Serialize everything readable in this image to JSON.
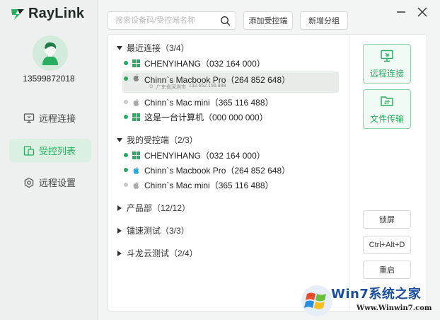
{
  "app": {
    "name": "RayLink",
    "brand_color": "#27ae60"
  },
  "user": {
    "id": "13599872018"
  },
  "sidebar": {
    "items": [
      {
        "label": "远程连接",
        "icon": "remote-desktop-icon",
        "active": false
      },
      {
        "label": "受控列表",
        "icon": "device-list-icon",
        "active": true
      },
      {
        "label": "远程设置",
        "icon": "settings-icon",
        "active": false
      }
    ]
  },
  "toolbar": {
    "search_placeholder": "搜索设备码/受控端名称",
    "add_device_label": "添加受控端",
    "add_group_label": "新增分组"
  },
  "groups": [
    {
      "label": "最近连接（3/4）",
      "expanded": true,
      "devices": [
        {
          "name": "CHENYIHANG（032 164 000）",
          "os": "windows",
          "online": true
        },
        {
          "name": "Chinn`s Macbook Pro（264 852 648）",
          "os": "mac",
          "online": true,
          "selected": true,
          "location": "广东省深圳市",
          "ip": "132.652.156.888"
        },
        {
          "name": "Chinn`s Mac mini（365 116 488）",
          "os": "mac",
          "online": false
        },
        {
          "name": "这是一台计算机（000 000 000）",
          "os": "windows",
          "online": true
        }
      ]
    },
    {
      "label": "我的受控端（2/3）",
      "expanded": true,
      "devices": [
        {
          "name": "CHENYIHANG（032 164 000）",
          "os": "windows",
          "online": true
        },
        {
          "name": "Chinn`s Macbook Pro（264 852 648）",
          "os": "mac",
          "online": true
        },
        {
          "name": "Chinn`s Mac mini（365 116 488）",
          "os": "mac",
          "online": false
        }
      ]
    },
    {
      "label": "产品部（12/12）",
      "expanded": false
    },
    {
      "label": "镭速测试（3/3）",
      "expanded": false
    },
    {
      "label": "斗龙云测试（2/4）",
      "expanded": false
    }
  ],
  "actions": {
    "remote_connect": "远程连接",
    "file_transfer": "文件传输",
    "lock_screen": "锁屏",
    "ctrl_alt_del": "Ctrl+Alt+D",
    "restart": "重启"
  },
  "watermark": {
    "title": "Win7系统之家",
    "url": "Www.Winwin7.com"
  }
}
